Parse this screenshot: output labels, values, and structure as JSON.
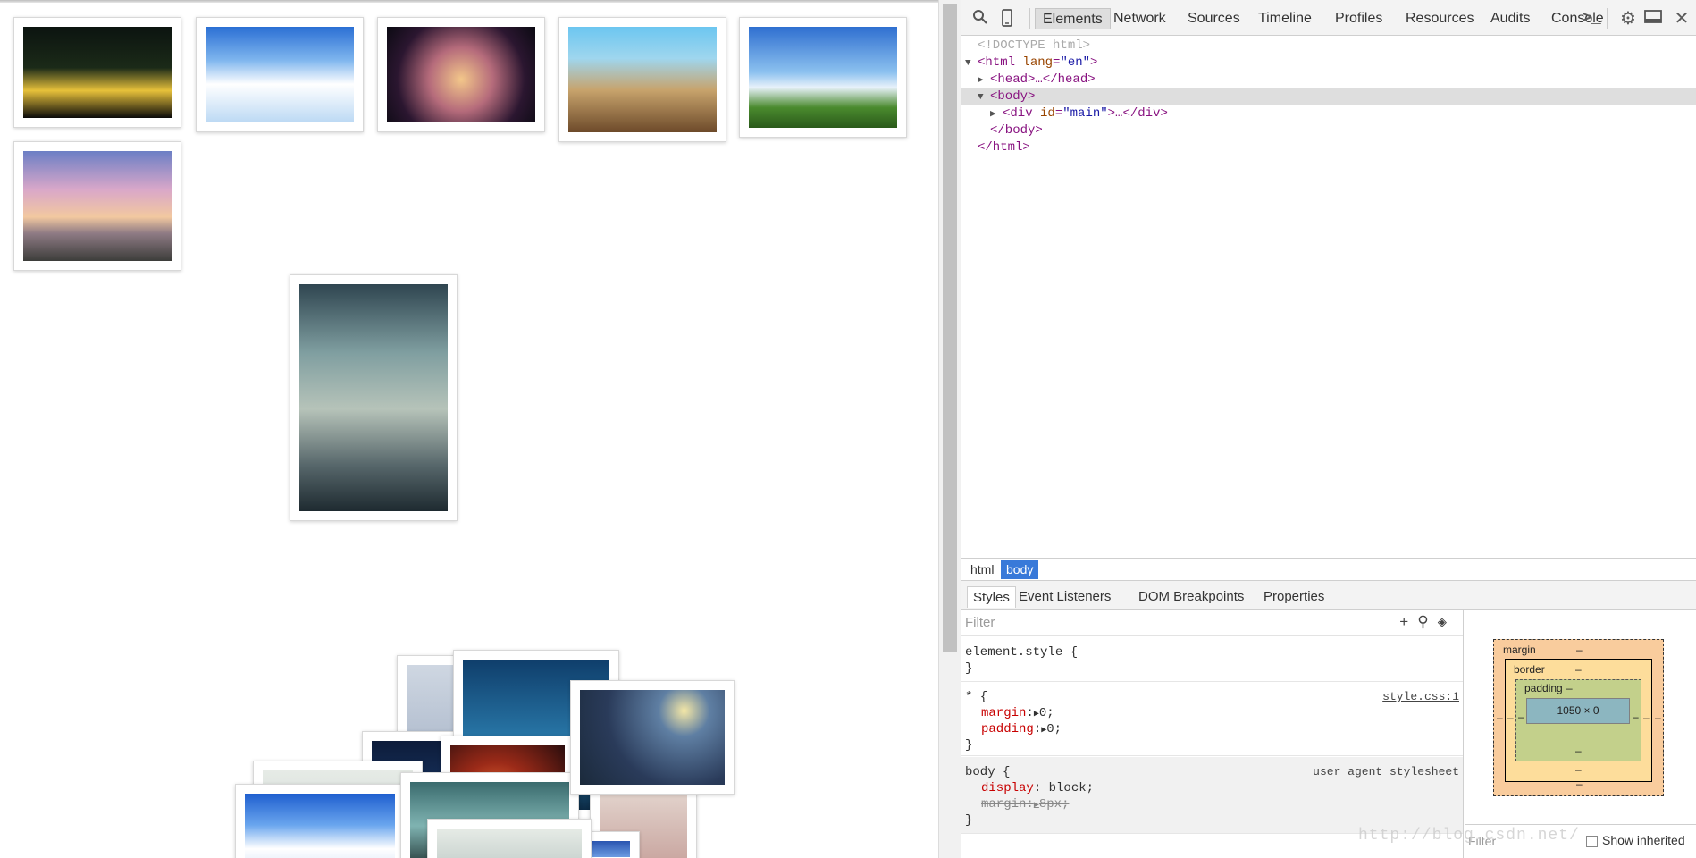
{
  "images": [
    {
      "name": "thumb-night-skyline",
      "bg": "linear-gradient(#0c1410 0%,#1b2a18 45%,#e7c13a 70%,#0a0a0a 100%)"
    },
    {
      "name": "thumb-clouds-house",
      "bg": "linear-gradient(#2b6fd4 0%,#7fb6ee 35%,#ffffff 60%,#bcd9f4 100%)"
    },
    {
      "name": "thumb-anime-girl",
      "bg": "radial-gradient(circle at 50% 55%,#f3c78a 0%,#b56b7b 35%,#2b1630 70%,#0b0a12 100%)"
    },
    {
      "name": "thumb-town-street",
      "bg": "linear-gradient(#6cc6f0 0%,#9fd6ee 30%,#c7a36c 60%,#6d4a2a 100%)"
    },
    {
      "name": "thumb-meadow-sky",
      "bg": "linear-gradient(#2f6fd0 0%,#8cc1ef 45%,#e8f2fa 60%,#4a8a2e 80%,#2a5a1a 100%)"
    },
    {
      "name": "thumb-sunset-bike",
      "bg": "linear-gradient(#6c7fc5 0%,#d9a7c9 35%,#f2c8a0 60%,#8e7a84 75%,#3c3d3a 100%)"
    },
    {
      "name": "thumb-eiffel-tower",
      "bg": "linear-gradient(#2f4550 0%,#7f9ea0 30%,#b6c3b9 55%,#56666a 80%,#1e2a30 100%)"
    },
    {
      "name": "stack-window-room",
      "bg": "linear-gradient(#cfd7e2,#9aa9bf)"
    },
    {
      "name": "stack-blue-room",
      "bg": "linear-gradient(#0f3e6b,#2c7fb0 60%,#0c2a44)"
    },
    {
      "name": "stack-totoro",
      "bg": "radial-gradient(circle at 72% 22%,#f4e7a6 0%,#5f7fa3 20%,#2a3b5a 60%,#1b2a3b 100%)"
    },
    {
      "name": "stack-city-night",
      "bg": "linear-gradient(#0d1c3a,#244d8a)"
    },
    {
      "name": "stack-emoji-lights",
      "bg": "radial-gradient(circle at 40% 50%,#ff7a3c 0%,#9b2a18 45%,#2a0d0d 100%)"
    },
    {
      "name": "stack-cherry-blossom",
      "bg": "linear-gradient(#e9dfd8,#c9a6a0)"
    },
    {
      "name": "stack-power-lines",
      "bg": "linear-gradient(#3a6b6e,#7fb3b1 50%,#1e3030)"
    },
    {
      "name": "stack-clouds-blue",
      "bg": "linear-gradient(#1f5fcf 0%,#6aa6ee 40%,#ffffff 70%,#d7e6f7 100%)"
    },
    {
      "name": "stack-pale-scene",
      "bg": "linear-gradient(#e6ebe6,#c9d3cf)"
    },
    {
      "name": "stack-blue-sky-small",
      "bg": "linear-gradient(#2a55b0,#6b9be2)"
    }
  ],
  "devtools": {
    "tabs": [
      "Elements",
      "Network",
      "Sources",
      "Timeline",
      "Profiles",
      "Resources",
      "Audits",
      "Console"
    ],
    "active_tab": "Elements",
    "dom": {
      "doctype": "<!DOCTYPE html>",
      "html_open": "<html",
      "html_attr": "lang",
      "html_val": "\"en\"",
      "head": "<head>…</head>",
      "body_open": "<body>",
      "div_tag": "<div",
      "div_attr": "id",
      "div_val": "\"main\"",
      "div_rest": ">…</div>",
      "body_close": "</body>",
      "html_close": "</html>"
    },
    "breadcrumbs": [
      "html",
      "body"
    ],
    "sub_tabs": [
      "Styles",
      "Event Listeners",
      "DOM Breakpoints",
      "Properties"
    ],
    "filter_placeholder": "Filter",
    "rules": {
      "element_style": "element.style {",
      "close": "}",
      "star_selector": "* {",
      "star_source": "style.css:1",
      "margin_prop": "margin",
      "padding_prop": "padding",
      "zero": "0;",
      "body_selector": "body {",
      "ua_source": "user agent stylesheet",
      "display_prop": "display",
      "display_val": "block;",
      "margin_val": "8px;"
    },
    "box_model": {
      "margin_label": "margin",
      "border_label": "border",
      "padding_label": "padding",
      "dash": "–",
      "content_size": "1050 × 0"
    },
    "bottom": {
      "filter_placeholder": "Filter",
      "show_inherited": "Show inherited"
    },
    "watermark": "http://blog.csdn.net/"
  }
}
